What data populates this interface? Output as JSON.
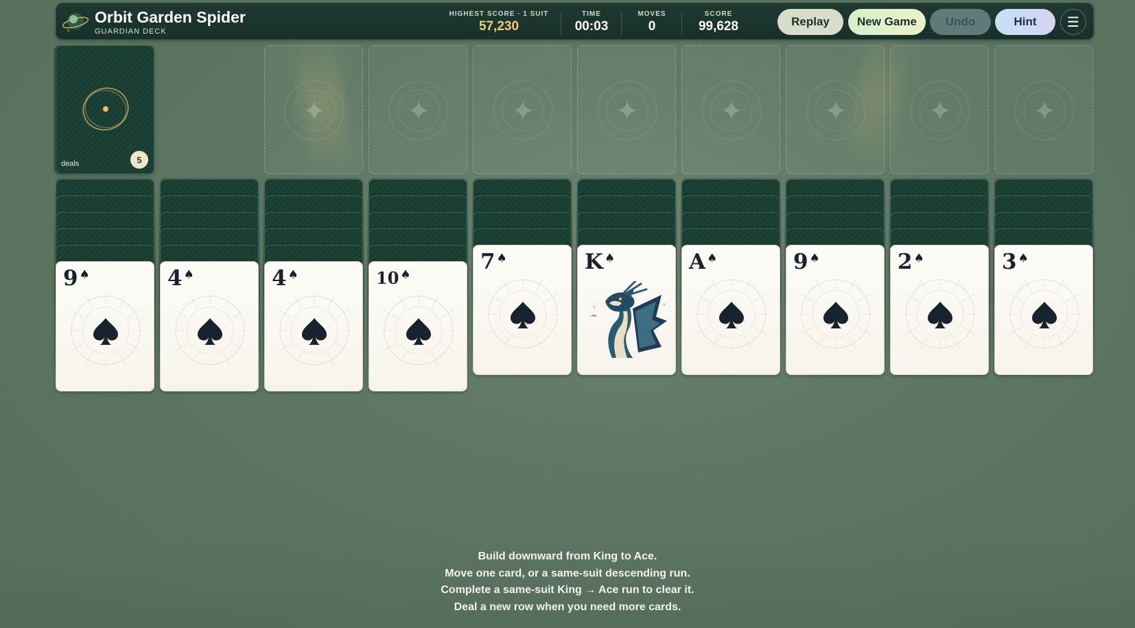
{
  "header": {
    "title": "Orbit Garden Spider",
    "subtitle": "GUARDIAN DECK",
    "stats": {
      "highest_label": "HIGHEST SCORE · 1 SUIT",
      "highest_value": "57,230",
      "time_label": "TIME",
      "time_value": "00:03",
      "moves_label": "MOVES",
      "moves_value": "0",
      "score_label": "SCORE",
      "score_value": "99,628"
    },
    "buttons": {
      "replay": "Replay",
      "new_game": "New Game",
      "undo": "Undo",
      "hint": "Hint"
    },
    "menu_icon": "☰"
  },
  "stock": {
    "label": "deals",
    "count": "5"
  },
  "foundations": {
    "count": 8,
    "icon": "sparkle-icon"
  },
  "tableau": {
    "columns": [
      {
        "hidden": 5,
        "rank": "9",
        "suit": "♠",
        "art": "spade"
      },
      {
        "hidden": 5,
        "rank": "4",
        "suit": "♠",
        "art": "spade"
      },
      {
        "hidden": 5,
        "rank": "4",
        "suit": "♠",
        "art": "spade"
      },
      {
        "hidden": 5,
        "rank": "10",
        "suit": "♠",
        "art": "spade"
      },
      {
        "hidden": 4,
        "rank": "7",
        "suit": "♠",
        "art": "spade"
      },
      {
        "hidden": 4,
        "rank": "K",
        "suit": "♠",
        "art": "dragon"
      },
      {
        "hidden": 4,
        "rank": "A",
        "suit": "♠",
        "art": "spade"
      },
      {
        "hidden": 4,
        "rank": "9",
        "suit": "♠",
        "art": "spade"
      },
      {
        "hidden": 4,
        "rank": "2",
        "suit": "♠",
        "art": "spade"
      },
      {
        "hidden": 4,
        "rank": "3",
        "suit": "♠",
        "art": "spade"
      }
    ]
  },
  "instructions": [
    "Build downward from King to Ace.",
    "Move one card, or a same-suit descending run.",
    "Complete a same-suit King → Ace run to clear it.",
    "Deal a new row when you need more cards."
  ],
  "colors": {
    "background": "#5d7663",
    "header": "#1f3a31",
    "gold": "#f0cd7a",
    "card_back": "#1a3b30",
    "card_face": "#fdfcf8"
  }
}
